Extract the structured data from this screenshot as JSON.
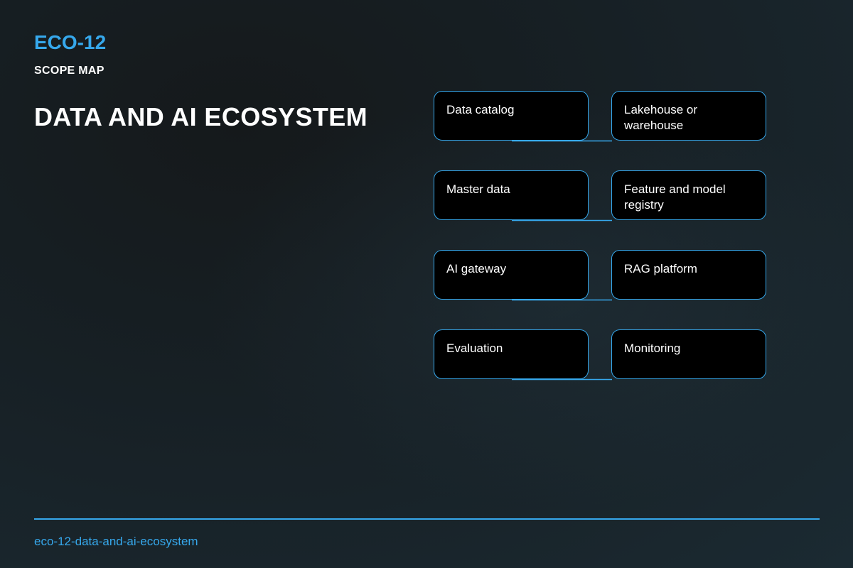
{
  "header": {
    "code": "ECO-12",
    "section_label": "SCOPE MAP"
  },
  "title": "DATA AND AI ECOSYSTEM",
  "nodes": [
    {
      "label": "Data catalog"
    },
    {
      "label": "Lakehouse or warehouse"
    },
    {
      "label": "Master data"
    },
    {
      "label": "Feature and model registry"
    },
    {
      "label": "AI gateway"
    },
    {
      "label": "RAG platform"
    },
    {
      "label": "Evaluation"
    },
    {
      "label": "Monitoring"
    }
  ],
  "footer": {
    "slug": "eco-12-data-and-ai-ecosystem"
  },
  "colors": {
    "accent": "#36a8ec",
    "node_fill": "#000000",
    "text": "#ffffff"
  }
}
